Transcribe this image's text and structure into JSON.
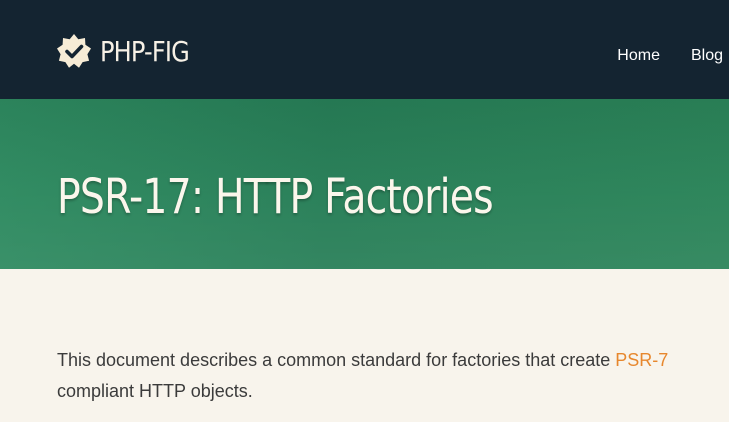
{
  "header": {
    "brand": "PHP-FIG",
    "nav": [
      {
        "label": "Home"
      },
      {
        "label": "Blog"
      }
    ]
  },
  "hero": {
    "title": "PSR-17: HTTP Factories"
  },
  "intro": {
    "before_link": "This document describes a common standard for factories that create ",
    "link_text": "PSR-7",
    "after_link": " compliant HTTP objects."
  },
  "colors": {
    "topbar": "#142431",
    "hero": "#2b8459",
    "page_bg": "#f8f4ec",
    "link": "#e7872d"
  }
}
